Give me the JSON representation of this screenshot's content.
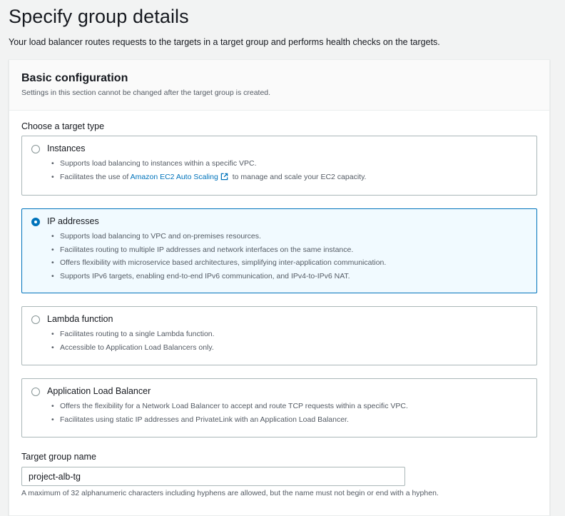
{
  "page": {
    "title": "Specify group details",
    "description": "Your load balancer routes requests to the targets in a target group and performs health checks on the targets."
  },
  "basic_config": {
    "title": "Basic configuration",
    "subtitle": "Settings in this section cannot be changed after the target group is created.",
    "target_type_label": "Choose a target type",
    "options": [
      {
        "title": "Instances",
        "selected": false,
        "bullets": [
          "Supports load balancing to instances within a specific VPC."
        ],
        "bullet2_prefix": "Facilitates the use of ",
        "bullet2_link": "Amazon EC2 Auto Scaling",
        "bullet2_suffix": " to manage and scale your EC2 capacity."
      },
      {
        "title": "IP addresses",
        "selected": true,
        "bullets": [
          "Supports load balancing to VPC and on-premises resources.",
          "Facilitates routing to multiple IP addresses and network interfaces on the same instance.",
          "Offers flexibility with microservice based architectures, simplifying inter-application communication.",
          "Supports IPv6 targets, enabling end-to-end IPv6 communication, and IPv4-to-IPv6 NAT."
        ]
      },
      {
        "title": "Lambda function",
        "selected": false,
        "bullets": [
          "Facilitates routing to a single Lambda function.",
          "Accessible to Application Load Balancers only."
        ]
      },
      {
        "title": "Application Load Balancer",
        "selected": false,
        "bullets": [
          "Offers the flexibility for a Network Load Balancer to accept and route TCP requests within a specific VPC.",
          "Facilitates using static IP addresses and PrivateLink with an Application Load Balancer."
        ]
      }
    ],
    "target_group_name": {
      "label": "Target group name",
      "value": "project-alb-tg",
      "constraint": "A maximum of 32 alphanumeric characters including hyphens are allowed, but the name must not begin or end with a hyphen."
    }
  },
  "colors": {
    "accent": "#0073bb",
    "selected_bg": "#f1faff",
    "border": "#aab7b8",
    "text": "#16191f",
    "secondary_text": "#545b64"
  },
  "icons": {
    "external_link": "external-link-icon"
  }
}
